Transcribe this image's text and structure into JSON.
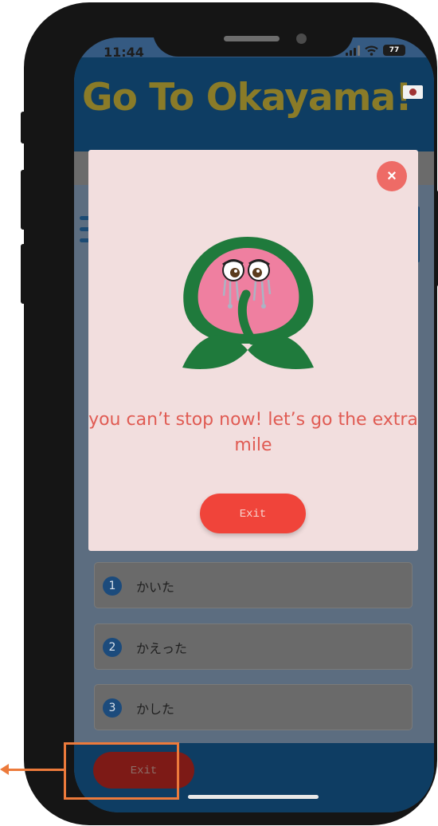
{
  "status_bar": {
    "time": "11:44",
    "battery": "77"
  },
  "app": {
    "title": "Go To Okayama!"
  },
  "modal": {
    "message": "you can’t stop now! let’s go the extra mile",
    "exit_label": "Exit",
    "close_symbol": "×"
  },
  "answers": [
    {
      "number": "1",
      "text": "かいた"
    },
    {
      "number": "2",
      "text": "かえった"
    },
    {
      "number": "3",
      "text": "かした"
    }
  ],
  "bottom": {
    "exit_label": "Exit"
  },
  "colors": {
    "accent": "#f0443a",
    "header": "#0e3d63",
    "annotation": "#ec7a3b",
    "modal_bg": "#f2dede"
  }
}
